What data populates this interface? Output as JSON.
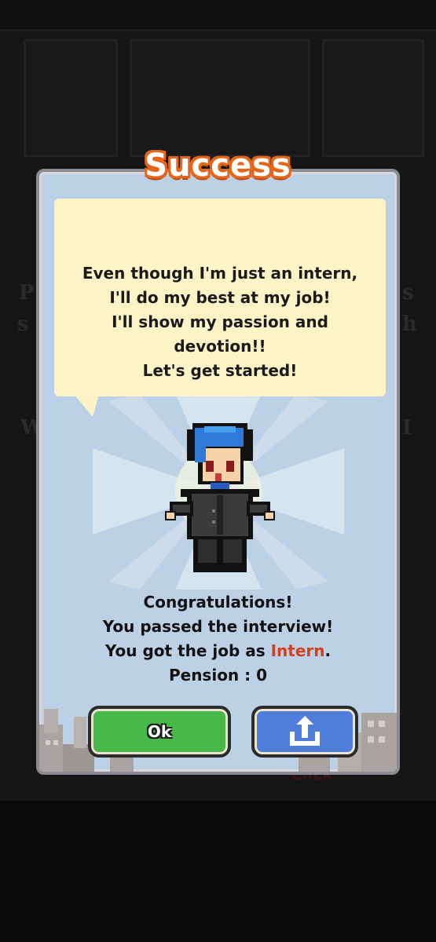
{
  "title": "Success",
  "speech_lines": [
    "Even though I'm just an intern,",
    "I'll do my best at my job!",
    "I'll show my passion and",
    "devotion!!",
    "Let's get started!"
  ],
  "message": {
    "line1": "Congratulations!",
    "line2": "You passed the interview!",
    "line3_prefix": "You got the job as ",
    "job_title": "Intern",
    "line3_suffix": ".",
    "pension_label": "Pension : ",
    "pension_value": "0"
  },
  "buttons": {
    "ok_label": "Ok",
    "share_icon": "share-upload-icon"
  },
  "background": {
    "click_hint": "Click"
  },
  "colors": {
    "title_outline": "#e3661b",
    "dialog_bg": "#bcd0e6",
    "bubble_bg": "#fcf3c7",
    "job_highlight": "#d3401c",
    "ok_button": "#47b94a",
    "share_button": "#4f7fdb"
  }
}
